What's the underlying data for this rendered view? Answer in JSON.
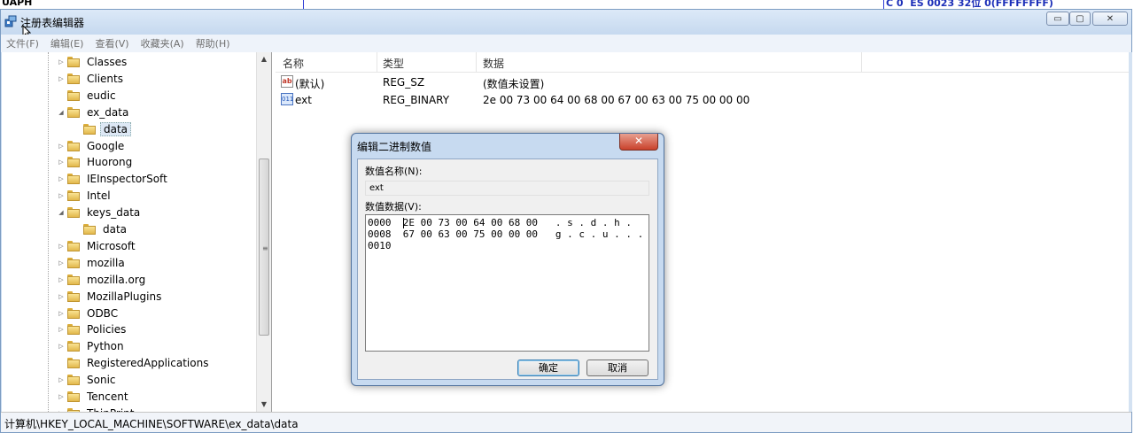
{
  "background": {
    "left_text": "UAPH",
    "right_text": "C 0  ES 0023 32位 0(FFFFFFFF)"
  },
  "window": {
    "title": "注册表编辑器",
    "icon": "regedit-icon",
    "controls": {
      "minimize": "▭",
      "maximize": "▢",
      "close": "✕"
    }
  },
  "menu": [
    "文件(F)",
    "编辑(E)",
    "查看(V)",
    "收藏夹(A)",
    "帮助(H)"
  ],
  "tree": {
    "items": [
      {
        "label": "Classes",
        "expander": "▷",
        "level": 0
      },
      {
        "label": "Clients",
        "expander": "▷",
        "level": 0
      },
      {
        "label": "eudic",
        "expander": "",
        "level": 0
      },
      {
        "label": "ex_data",
        "expander": "◢",
        "level": 0
      },
      {
        "label": "data",
        "expander": "",
        "level": 1,
        "selected": true
      },
      {
        "label": "Google",
        "expander": "▷",
        "level": 0
      },
      {
        "label": "Huorong",
        "expander": "▷",
        "level": 0
      },
      {
        "label": "IEInspectorSoft",
        "expander": "▷",
        "level": 0
      },
      {
        "label": "Intel",
        "expander": "▷",
        "level": 0
      },
      {
        "label": "keys_data",
        "expander": "◢",
        "level": 0
      },
      {
        "label": "data",
        "expander": "",
        "level": 1
      },
      {
        "label": "Microsoft",
        "expander": "▷",
        "level": 0
      },
      {
        "label": "mozilla",
        "expander": "▷",
        "level": 0
      },
      {
        "label": "mozilla.org",
        "expander": "▷",
        "level": 0
      },
      {
        "label": "MozillaPlugins",
        "expander": "▷",
        "level": 0
      },
      {
        "label": "ODBC",
        "expander": "▷",
        "level": 0
      },
      {
        "label": "Policies",
        "expander": "▷",
        "level": 0
      },
      {
        "label": "Python",
        "expander": "▷",
        "level": 0
      },
      {
        "label": "RegisteredApplications",
        "expander": "",
        "level": 0
      },
      {
        "label": "Sonic",
        "expander": "▷",
        "level": 0
      },
      {
        "label": "Tencent",
        "expander": "▷",
        "level": 0
      },
      {
        "label": "ThinPrint",
        "expander": "▷",
        "level": 0
      }
    ],
    "scroll": {
      "up": "▲",
      "down": "▼",
      "grip": "≡"
    }
  },
  "list": {
    "columns": [
      "名称",
      "类型",
      "数据"
    ],
    "rows": [
      {
        "icon": "ab",
        "name": "(默认)",
        "type": "REG_SZ",
        "data": "(数值未设置)"
      },
      {
        "icon": "011",
        "name": "ext",
        "type": "REG_BINARY",
        "data": "2e 00 73 00 64 00 68 00 67 00 63 00 75 00 00 00"
      }
    ]
  },
  "status": {
    "path": "计算机\\HKEY_LOCAL_MACHINE\\SOFTWARE\\ex_data\\data"
  },
  "dialog": {
    "title": "编辑二进制数值",
    "close": "✕",
    "name_label": "数值名称(N):",
    "name_value": "ext",
    "data_label": "数值数据(V):",
    "hex_lines": [
      "0000  2E 00 73 00 64 00 68 00   . s . d . h .",
      "0008  67 00 63 00 75 00 00 00   g . c . u . . .",
      "0010"
    ],
    "ok": "确定",
    "cancel": "取消"
  }
}
